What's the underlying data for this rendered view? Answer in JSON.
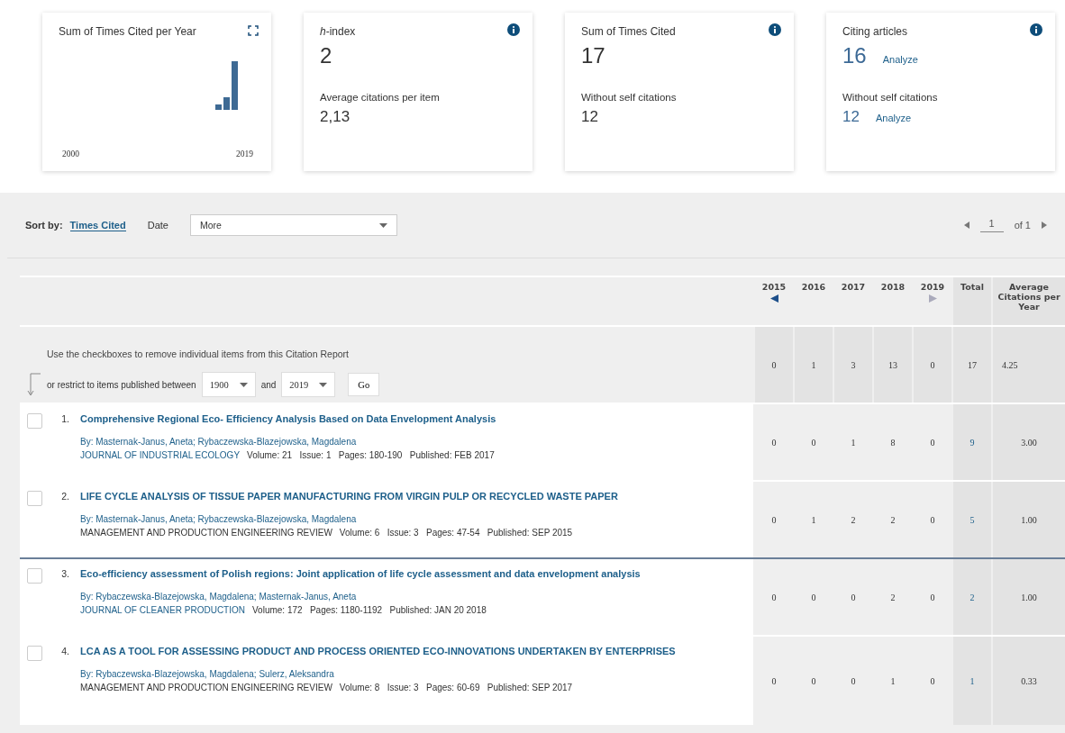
{
  "cards": [
    {
      "kind": "chart",
      "title": "Sum of Times Cited per Year",
      "axis_start": "2000",
      "axis_end": "2019"
    },
    {
      "kind": "metric",
      "title": "*h*-index",
      "value": "2",
      "sub_label": "Average citations per item",
      "sub_value": "2,13"
    },
    {
      "kind": "metric",
      "title": "Sum of Times Cited",
      "value": "17",
      "sub_label": "Without self citations",
      "sub_value": "12"
    },
    {
      "kind": "metric",
      "title": "Citing articles",
      "value": "16",
      "value_link": "Analyze",
      "sub_label": "Without self citations",
      "sub_value": "12",
      "sub_link": "Analyze"
    }
  ],
  "sort": {
    "label": "Sort by:",
    "options": [
      {
        "label": "Times Cited",
        "selected": true
      },
      {
        "label": "Date",
        "selected": false
      }
    ],
    "dropdown": "More"
  },
  "pagination": {
    "page": "1",
    "of": "of 1"
  },
  "table": {
    "years": [
      {
        "label": "2015"
      },
      {
        "label": "2016"
      },
      {
        "label": "2017"
      },
      {
        "label": "2018"
      },
      {
        "label": "2019"
      }
    ],
    "scroll_back": {
      "enabled": true
    },
    "scroll_forward": {
      "enabled": false
    },
    "total_label": "Total",
    "average_label": "Average Citations per Year",
    "instruction": "Use the checkboxes to remove individual items from this Citation Report",
    "restrict": {
      "label": "or restrict to items published between",
      "from": "1900",
      "and": "and",
      "to": "2019",
      "go": "Go"
    },
    "summary": {
      "years": [
        "0",
        "1",
        "3",
        "13",
        "0"
      ],
      "total": "17",
      "average": "4.25"
    },
    "rows": [
      {
        "number": "1.",
        "checked": false,
        "highlighted": false,
        "title": "Comprehensive Regional Eco- Efficiency Analysis Based on Data Envelopment Analysis",
        "authors": "By: Masternak-Janus, Aneta; Rybaczewska-Blazejowska, Magdalena",
        "journal": "JOURNAL OF INDUSTRIAL ECOLOGY",
        "journal_link": true,
        "details": "Volume: 21   Issue: 1   Pages: 180-190   Published: FEB 2017",
        "years": [
          "0",
          "0",
          "1",
          "8",
          "0"
        ],
        "total": "9",
        "average": "3.00"
      },
      {
        "number": "2.",
        "checked": false,
        "highlighted": false,
        "title": "LIFE CYCLE ANALYSIS OF TISSUE PAPER MANUFACTURING FROM VIRGIN PULP OR RECYCLED WASTE PAPER",
        "authors": "By: Masternak-Janus, Aneta; Rybaczewska-Blazejowska, Magdalena",
        "journal": "MANAGEMENT AND PRODUCTION ENGINEERING REVIEW",
        "journal_link": false,
        "details": "Volume: 6   Issue: 3   Pages: 47-54   Published: SEP 2015",
        "years": [
          "0",
          "1",
          "2",
          "2",
          "0"
        ],
        "total": "5",
        "average": "1.00"
      },
      {
        "number": "3.",
        "checked": false,
        "highlighted": true,
        "title": "Eco-efficiency assessment of Polish regions: Joint application of life cycle assessment and data envelopment analysis",
        "authors": "By: Rybaczewska-Blazejowska, Magdalena; Masternak-Janus, Aneta",
        "journal": "JOURNAL OF CLEANER PRODUCTION",
        "journal_link": true,
        "details": "Volume: 172   Pages: 1180-1192   Published: JAN 20 2018",
        "years": [
          "0",
          "0",
          "0",
          "2",
          "0"
        ],
        "total": "2",
        "average": "1.00"
      },
      {
        "number": "4.",
        "checked": false,
        "highlighted": false,
        "title": "LCA AS A TOOL FOR ASSESSING PRODUCT AND PROCESS ORIENTED ECO-INNOVATIONS UNDERTAKEN BY ENTERPRISES",
        "authors": "By: Rybaczewska-Blazejowska, Magdalena; Sulerz, Aleksandra",
        "journal": "MANAGEMENT AND PRODUCTION ENGINEERING REVIEW",
        "journal_link": false,
        "details": "Volume: 8   Issue: 3   Pages: 60-69   Published: SEP 2017",
        "years": [
          "0",
          "0",
          "0",
          "1",
          "0"
        ],
        "total": "1",
        "average": "0.33"
      }
    ]
  }
}
